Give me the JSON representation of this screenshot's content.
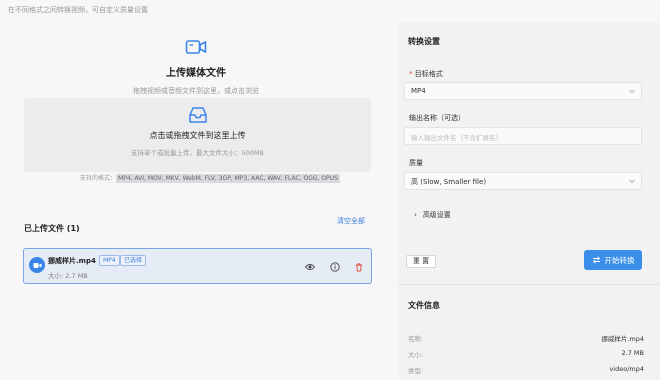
{
  "top_desc": "在不同格式之间转换视频，可自定义质量设置",
  "upload": {
    "title": "上传媒体文件",
    "subtitle": "拖拽视频或音频文件到这里，或点击浏览",
    "drop_title": "点击或拖拽文件到这里上传",
    "drop_sub": "支持单个或批量上传，最大文件大小：500MB",
    "formats_label": "支持的格式：",
    "formats_list": "MP4, AVI, MOV, MKV, WebM, FLV, 3GP, MP3, AAC, WAV, FLAC, OGG, OPUS"
  },
  "uploaded": {
    "title": "已上传文件 (1)",
    "clear_all": "清空全部",
    "file": {
      "name": "挪威样片.mp4",
      "format_tag": "MP4",
      "selected_tag": "已选择",
      "size": "大小: 2.7 MB"
    }
  },
  "settings": {
    "title": "转换设置",
    "target_format_label": "目标格式",
    "target_format_required": "*",
    "target_format_value": "MP4",
    "output_name_label": "输出名称（可选）",
    "output_name_placeholder": "输入输出文件名（不含扩展名）",
    "quality_label": "质量",
    "quality_value": "高 (Slow, Smaller file)",
    "advanced": "高级设置",
    "reset": "重 置",
    "start": "开始转换"
  },
  "file_info": {
    "title": "文件信息",
    "rows": [
      {
        "label": "名称:",
        "value": "挪威样片.mp4"
      },
      {
        "label": "大小:",
        "value": "2.7 MB"
      },
      {
        "label": "类型:",
        "value": "video/mp4"
      }
    ]
  },
  "colors": {
    "accent": "#3a8ee8",
    "link": "#3a7bd5",
    "danger": "#e04a3a"
  }
}
